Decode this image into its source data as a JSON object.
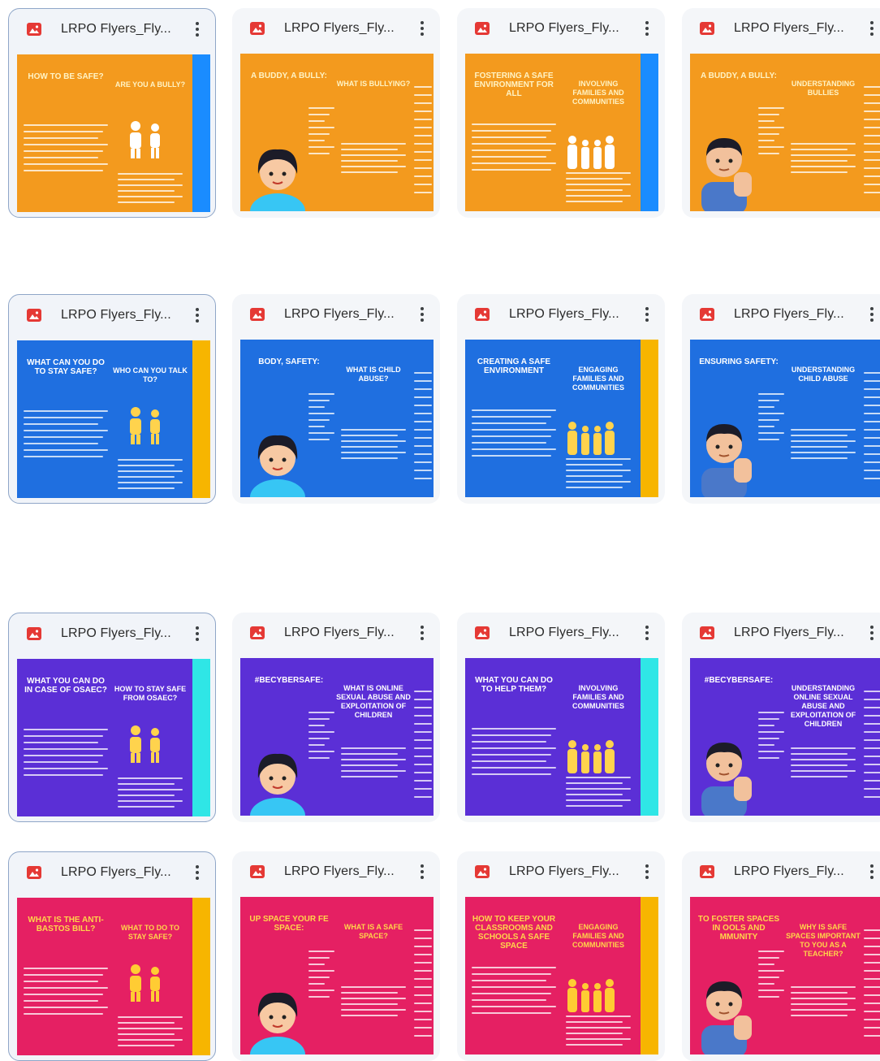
{
  "colors": {
    "card_bg": "#f4f6f9",
    "selected_border": "#8fa6c8",
    "file_icon": "#e53935",
    "orange": "#f39a1e",
    "blue": "#1f6fe0",
    "purple": "#5b2fd6",
    "pink": "#e52063",
    "strip_blue": "#1a8cff",
    "strip_yellow": "#f7b500",
    "strip_cyan": "#2fe6e6"
  },
  "icons": {
    "file_type": "image-file-icon",
    "more": "more-vert-icon"
  },
  "files": [
    {
      "name": "LRPO Flyers_Fly...",
      "theme": "orange",
      "strip": "strip_blue",
      "selected": true,
      "headings": [
        "HOW TO BE SAFE?",
        "ARE YOU A BULLY?"
      ],
      "figure": "people"
    },
    {
      "name": "LRPO Flyers_Fly...",
      "theme": "orange",
      "strip": null,
      "selected": false,
      "headings": [
        "A BUDDY, A BULLY:",
        "WHAT IS BULLYING?"
      ],
      "figure": "girl"
    },
    {
      "name": "LRPO Flyers_Fly...",
      "theme": "orange",
      "strip": "strip_blue",
      "selected": false,
      "headings": [
        "FOSTERING A SAFE ENVIRONMENT FOR ALL",
        "INVOLVING FAMILIES AND COMMUNITIES"
      ],
      "figure": "family"
    },
    {
      "name": "LRPO Flyers_Fly...",
      "theme": "orange",
      "strip": null,
      "selected": false,
      "headings": [
        "A BUDDY, A BULLY:",
        "UNDERSTANDING BULLIES"
      ],
      "figure": "boy"
    },
    {
      "name": "LRPO Flyers_Fly...",
      "theme": "blue",
      "strip": "strip_yellow",
      "selected": true,
      "headings": [
        "WHAT CAN YOU DO TO STAY SAFE?",
        "WHO CAN YOU TALK TO?"
      ],
      "figure": "people"
    },
    {
      "name": "LRPO Flyers_Fly...",
      "theme": "blue",
      "strip": null,
      "selected": false,
      "headings": [
        "BODY, SAFETY:",
        "WHAT IS CHILD ABUSE?"
      ],
      "figure": "girl"
    },
    {
      "name": "LRPO Flyers_Fly...",
      "theme": "blue",
      "strip": "strip_yellow",
      "selected": false,
      "headings": [
        "CREATING A SAFE ENVIRONMENT",
        "ENGAGING FAMILIES AND COMMUNITIES"
      ],
      "figure": "family"
    },
    {
      "name": "LRPO Flyers_Fly...",
      "theme": "blue",
      "strip": null,
      "selected": false,
      "headings": [
        "ENSURING SAFETY:",
        "UNDERSTANDING CHILD ABUSE"
      ],
      "figure": "boy"
    },
    {
      "name": "LRPO Flyers_Fly...",
      "theme": "purple",
      "strip": "strip_cyan",
      "selected": true,
      "headings": [
        "WHAT YOU CAN DO IN CASE OF OSAEC?",
        "HOW TO STAY SAFE FROM OSAEC?"
      ],
      "figure": "people"
    },
    {
      "name": "LRPO Flyers_Fly...",
      "theme": "purple",
      "strip": null,
      "selected": false,
      "headings": [
        "#BECYBERSAFE:",
        "WHAT IS ONLINE SEXUAL ABUSE AND EXPLOITATION OF CHILDREN"
      ],
      "figure": "girl"
    },
    {
      "name": "LRPO Flyers_Fly...",
      "theme": "purple",
      "strip": "strip_cyan",
      "selected": false,
      "headings": [
        "WHAT YOU CAN DO TO HELP THEM?",
        "INVOLVING FAMILIES AND COMMUNITIES"
      ],
      "figure": "family"
    },
    {
      "name": "LRPO Flyers_Fly...",
      "theme": "purple",
      "strip": null,
      "selected": false,
      "headings": [
        "#BECYBERSAFE:",
        "UNDERSTANDING ONLINE SEXUAL ABUSE AND EXPLOITATION OF CHILDREN"
      ],
      "figure": "boy"
    },
    {
      "name": "LRPO Flyers_Fly...",
      "theme": "pink",
      "strip": "strip_yellow",
      "selected": true,
      "headings": [
        "WHAT IS THE ANTI-BASTOS BILL?",
        "WHAT TO DO TO STAY SAFE?"
      ],
      "figure": "people"
    },
    {
      "name": "LRPO Flyers_Fly...",
      "theme": "pink",
      "strip": null,
      "selected": false,
      "headings": [
        "UP SPACE YOUR FE SPACE:",
        "WHAT IS A SAFE SPACE?"
      ],
      "figure": "girl"
    },
    {
      "name": "LRPO Flyers_Fly...",
      "theme": "pink",
      "strip": "strip_yellow",
      "selected": false,
      "headings": [
        "HOW TO KEEP YOUR CLASSROOMS AND SCHOOLS A SAFE SPACE",
        "ENGAGING FAMILIES AND COMMUNITIES"
      ],
      "figure": "family"
    },
    {
      "name": "LRPO Flyers_Fly...",
      "theme": "pink",
      "strip": null,
      "selected": false,
      "headings": [
        "TO FOSTER SPACES IN OOLS AND MMUNITY",
        "WHY IS SAFE SPACES IMPORTANT TO YOU AS A TEACHER?"
      ],
      "figure": "boy"
    }
  ]
}
